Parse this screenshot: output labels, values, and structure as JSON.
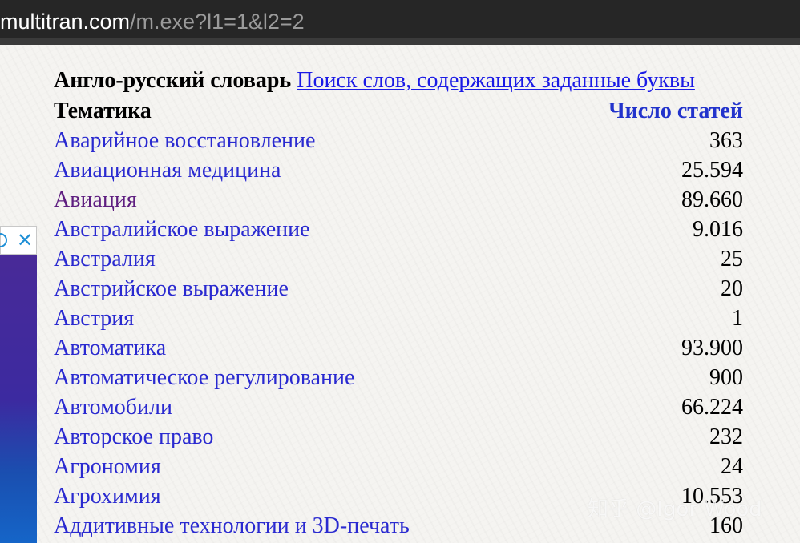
{
  "browser": {
    "url_host": "multitran.com",
    "url_path": "/m.exe?l1=1&l2=2"
  },
  "header": {
    "dict_title": "Англо-русский словарь",
    "search_link": "Поиск слов, содержащих заданные буквы"
  },
  "table": {
    "col_topic": "Тематика",
    "col_count": "Число статей",
    "rows": [
      {
        "topic": "Аварийное восстановление",
        "count": "363"
      },
      {
        "topic": "Авиационная медицина",
        "count": "25.594"
      },
      {
        "topic": "Авиация",
        "count": "89.660"
      },
      {
        "topic": "Австралийское выражение",
        "count": "9.016"
      },
      {
        "topic": "Австралия",
        "count": "25"
      },
      {
        "topic": "Австрийское выражение",
        "count": "20"
      },
      {
        "topic": "Австрия",
        "count": "1"
      },
      {
        "topic": "Автоматика",
        "count": "93.900"
      },
      {
        "topic": "Автоматическое регулирование",
        "count": "900"
      },
      {
        "topic": "Автомобили",
        "count": "66.224"
      },
      {
        "topic": "Авторское право",
        "count": "232"
      },
      {
        "topic": "Агрономия",
        "count": "24"
      },
      {
        "topic": "Агрохимия",
        "count": "10.553"
      },
      {
        "topic": "Аддитивные технологии и 3D-печать",
        "count": "160"
      }
    ]
  },
  "ad": {
    "close_glyph": "✕"
  },
  "watermark": "知乎 @Igor Wood",
  "colors": {
    "link": "#2a2ad0",
    "visited_link": "#5e1e80",
    "header_count": "#2233cc",
    "urlbar_bg": "#262626"
  }
}
